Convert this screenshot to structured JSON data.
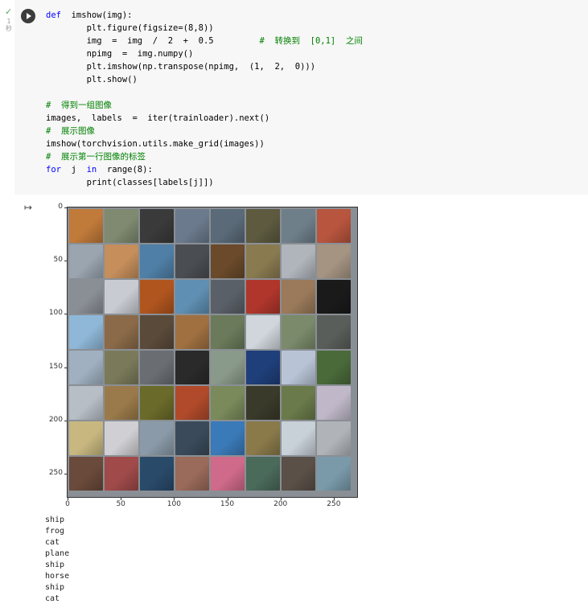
{
  "cell": {
    "exec_status": "✓",
    "exec_time": "1\n秒",
    "code_lines": [
      [
        {
          "t": "def",
          "c": "kw"
        },
        {
          "t": "  imshow(img):",
          "c": ""
        }
      ],
      [
        {
          "t": "        plt.figure(figsize=(8,8))",
          "c": ""
        }
      ],
      [
        {
          "t": "        img  =  img  /  2  +  0.5         ",
          "c": ""
        },
        {
          "t": "#  转换到  [0,1]  之间",
          "c": "cm"
        }
      ],
      [
        {
          "t": "        npimg  =  img.numpy()",
          "c": ""
        }
      ],
      [
        {
          "t": "        plt.imshow(np.transpose(npimg,  (1,  2,  0)))",
          "c": ""
        }
      ],
      [
        {
          "t": "        plt.show()",
          "c": ""
        }
      ],
      [
        {
          "t": "",
          "c": ""
        }
      ],
      [
        {
          "t": "#  得到一组图像",
          "c": "cm"
        }
      ],
      [
        {
          "t": "images,  labels  =  iter(trainloader).next()",
          "c": ""
        }
      ],
      [
        {
          "t": "#  展示图像",
          "c": "cm"
        }
      ],
      [
        {
          "t": "imshow(torchvision.utils.make_grid(images))",
          "c": ""
        }
      ],
      [
        {
          "t": "#  展示第一行图像的标签",
          "c": "cm"
        }
      ],
      [
        {
          "t": "for",
          "c": "kw"
        },
        {
          "t": "  j  ",
          "c": ""
        },
        {
          "t": "in",
          "c": "kw"
        },
        {
          "t": "  range(8):",
          "c": ""
        }
      ],
      [
        {
          "t": "        print(classes[labels[j]])",
          "c": ""
        }
      ]
    ]
  },
  "output": {
    "icon": "output-icon",
    "plot": {
      "y_ticks": [
        "0",
        "50",
        "100",
        "150",
        "200",
        "250"
      ],
      "x_ticks": [
        "0",
        "50",
        "100",
        "150",
        "200",
        "250"
      ],
      "tile_colors": [
        [
          "#c07a3a",
          "#7f8a70",
          "#3a3a3a",
          "#6b7a8c",
          "#5a6a78",
          "#5d5a40",
          "#6f7f8a",
          "#b8553e"
        ],
        [
          "#9aa5b0",
          "#c58e5b",
          "#4f7fa6",
          "#4a4d52",
          "#6a4a2a",
          "#8a7a50",
          "#b0b5bc",
          "#a59482"
        ],
        [
          "#8a8f96",
          "#c8ccd2",
          "#b0551e",
          "#5f8fb2",
          "#5a6068",
          "#b0362c",
          "#9a7a5a",
          "#1a1a1a"
        ],
        [
          "#8fb8d8",
          "#8a6a48",
          "#5a4a3a",
          "#a07040",
          "#6a7a5a",
          "#d0d6dc",
          "#7a8a6a",
          "#5a5e5a"
        ],
        [
          "#a0b0c0",
          "#7a7a5a",
          "#6a6e72",
          "#2a2a2a",
          "#8a9a8a",
          "#1f3f7a",
          "#b8c4d6",
          "#4a6a3a"
        ],
        [
          "#b8bec6",
          "#9a7a4a",
          "#6a6a2a",
          "#b04a2a",
          "#7a8a5a",
          "#3a3a2a",
          "#6a7a4a",
          "#c0b8c8"
        ],
        [
          "#c8b880",
          "#d0d0d4",
          "#8a9aa8",
          "#3a4a5a",
          "#3a7ab8",
          "#8a7a4a",
          "#c8d0d8",
          "#b0b4b8"
        ],
        [
          "#6a4a3a",
          "#a04a4a",
          "#2a4a6a",
          "#9a6a5a",
          "#d06a8a",
          "#4a6a5a",
          "#5a5048",
          "#7a9aaa"
        ]
      ]
    },
    "stdout": [
      "ship",
      "frog",
      "cat",
      "plane",
      "ship",
      "horse",
      "ship",
      "cat"
    ]
  }
}
